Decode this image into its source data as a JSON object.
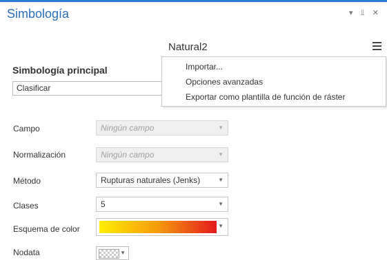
{
  "pane": {
    "title": "Simbología",
    "controls": {
      "dropdown": "▾",
      "pin": "⫫",
      "close": "✕"
    }
  },
  "layer_name": "Natural2",
  "primary": {
    "title": "Simbología principal",
    "renderer": "Clasificar"
  },
  "menu": {
    "items": [
      "Importar...",
      "Opciones avanzadas",
      "Exportar como plantilla de función de ráster"
    ]
  },
  "fields": {
    "campo": {
      "label": "Campo",
      "value": "Ningún campo",
      "enabled": false
    },
    "normalizacion": {
      "label": "Normalización",
      "value": "Ningún campo",
      "enabled": false
    },
    "metodo": {
      "label": "Método",
      "value": "Rupturas naturales (Jenks)",
      "enabled": true
    },
    "clases": {
      "label": "Clases",
      "value": "5",
      "enabled": true
    },
    "esquema": {
      "label": "Esquema de color",
      "ramp_colors": [
        "#ffee00",
        "#f59a0d",
        "#e41a1c"
      ]
    },
    "nodata": {
      "label": "Nodata",
      "swatch": "transparent-checker"
    }
  },
  "icons": {
    "hamburger": "menu-icon",
    "dropdown_arrow": "▼"
  }
}
